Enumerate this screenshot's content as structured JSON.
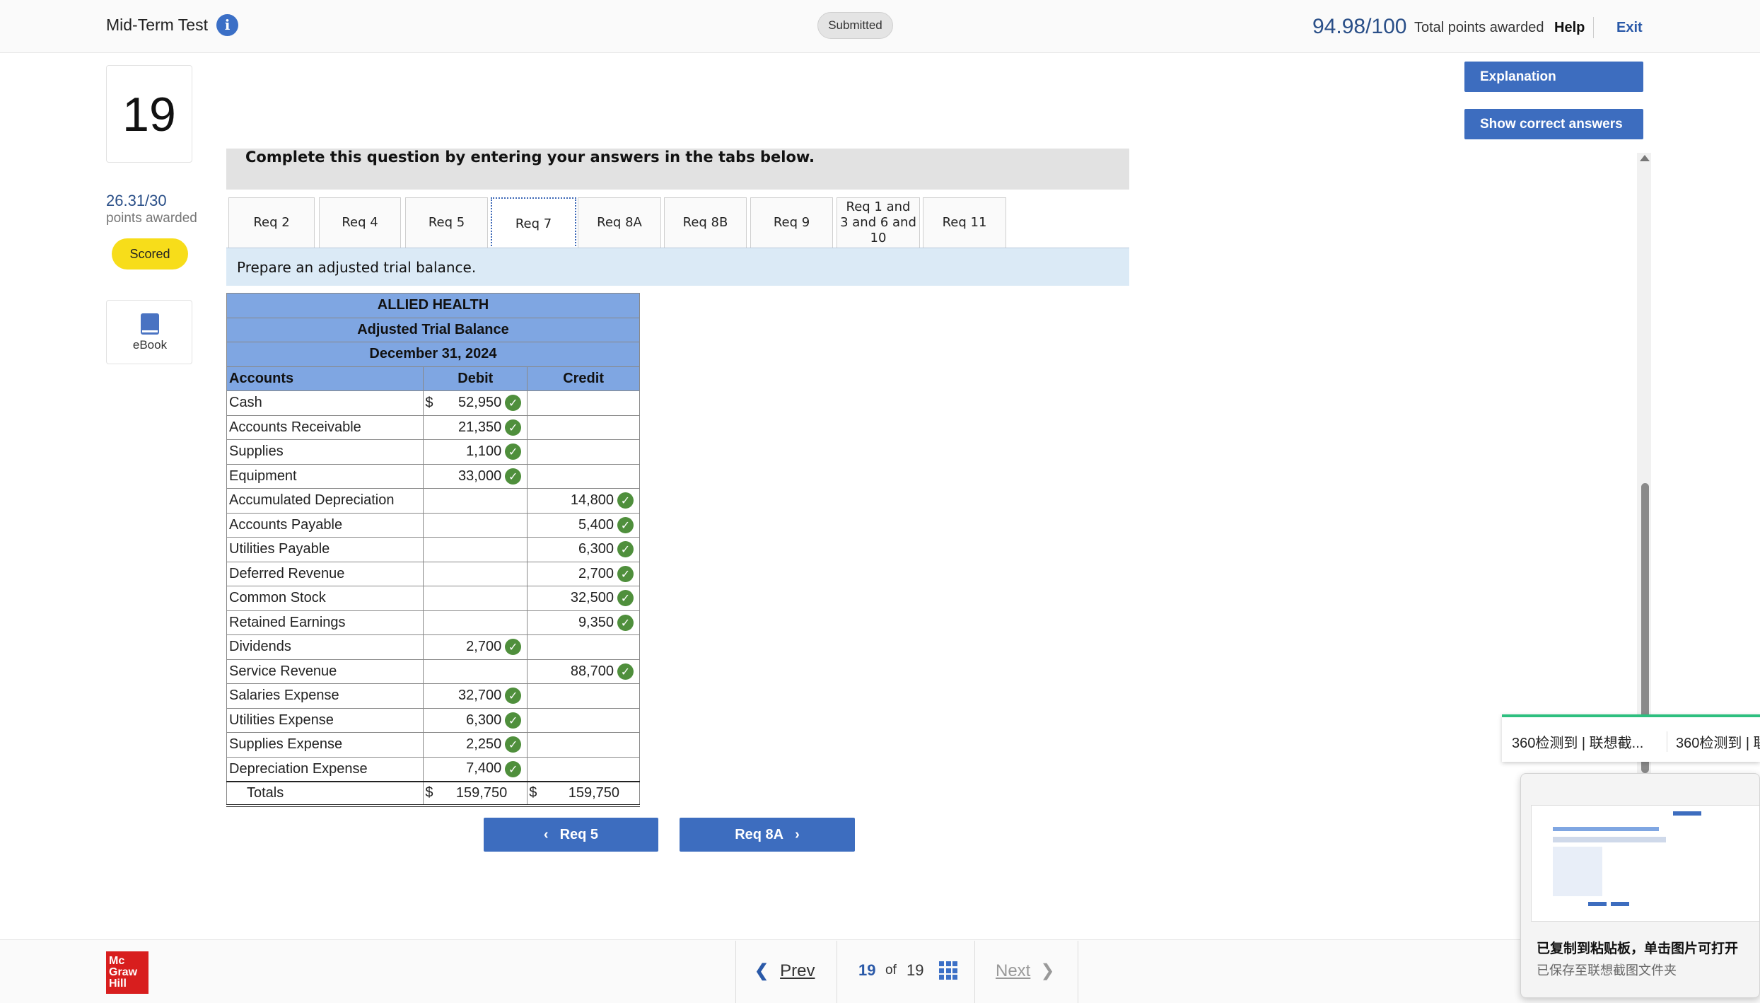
{
  "header": {
    "title": "Mid-Term Test",
    "status": "Submitted",
    "total_score": "94.98/100",
    "total_label": "Total points awarded",
    "help": "Help",
    "exit": "Exit"
  },
  "question": {
    "number": "19",
    "score": "26.31/30",
    "score_label": "points awarded",
    "status": "Scored",
    "ebook": "eBook"
  },
  "actions": {
    "explanation": "Explanation",
    "show_answers": "Show correct answers"
  },
  "instruction": "Complete this question by entering your answers in the tabs below.",
  "tabs": [
    {
      "label": "Req 2"
    },
    {
      "label": "Req 4"
    },
    {
      "label": "Req 5"
    },
    {
      "label": "Req 7",
      "active": true
    },
    {
      "label": "Req 8A"
    },
    {
      "label": "Req 8B"
    },
    {
      "label": "Req 9"
    },
    {
      "label": "Req 1 and 3 and 6 and 10"
    },
    {
      "label": "Req 11"
    }
  ],
  "prompt": "Prepare an adjusted trial balance.",
  "trial_balance": {
    "company": "ALLIED HEALTH",
    "title": "Adjusted Trial Balance",
    "date": "December 31, 2024",
    "columns": [
      "Accounts",
      "Debit",
      "Credit"
    ],
    "currency_symbol": "$",
    "rows": [
      {
        "account": "Cash",
        "debit": "52,950",
        "credit": ""
      },
      {
        "account": "Accounts Receivable",
        "debit": "21,350",
        "credit": ""
      },
      {
        "account": "Supplies",
        "debit": "1,100",
        "credit": ""
      },
      {
        "account": "Equipment",
        "debit": "33,000",
        "credit": ""
      },
      {
        "account": "Accumulated Depreciation",
        "debit": "",
        "credit": "14,800"
      },
      {
        "account": "Accounts Payable",
        "debit": "",
        "credit": "5,400"
      },
      {
        "account": "Utilities Payable",
        "debit": "",
        "credit": "6,300"
      },
      {
        "account": "Deferred Revenue",
        "debit": "",
        "credit": "2,700"
      },
      {
        "account": "Common Stock",
        "debit": "",
        "credit": "32,500"
      },
      {
        "account": "Retained Earnings",
        "debit": "",
        "credit": "9,350"
      },
      {
        "account": "Dividends",
        "debit": "2,700",
        "credit": ""
      },
      {
        "account": "Service Revenue",
        "debit": "",
        "credit": "88,700"
      },
      {
        "account": "Salaries Expense",
        "debit": "32,700",
        "credit": ""
      },
      {
        "account": "Utilities Expense",
        "debit": "6,300",
        "credit": ""
      },
      {
        "account": "Supplies Expense",
        "debit": "2,250",
        "credit": ""
      },
      {
        "account": "Depreciation Expense",
        "debit": "7,400",
        "credit": ""
      }
    ],
    "totals": {
      "label": "Totals",
      "debit": "159,750",
      "credit": "159,750"
    }
  },
  "nav_buttons": {
    "prev": "Req 5",
    "next": "Req 8A"
  },
  "footer": {
    "logo": "Mc Graw Hill",
    "prev": "Prev",
    "current_page": "19",
    "of": "of",
    "total_pages": "19",
    "next": "Next"
  },
  "overlay": {
    "notification_1": "360检测到 | 联想截...",
    "notification_2": "360检测到 | 联",
    "clipboard_title": "已复制到粘贴板，单击图片可打开",
    "clipboard_subtitle": "已保存至联想截图文件夹"
  },
  "colors": {
    "accent": "#3d6dbf",
    "table_header": "#7fa6e2",
    "prompt_band": "#dbeaf6",
    "correct_check": "#4f8f3c",
    "scored_badge": "#f7dd1a"
  }
}
